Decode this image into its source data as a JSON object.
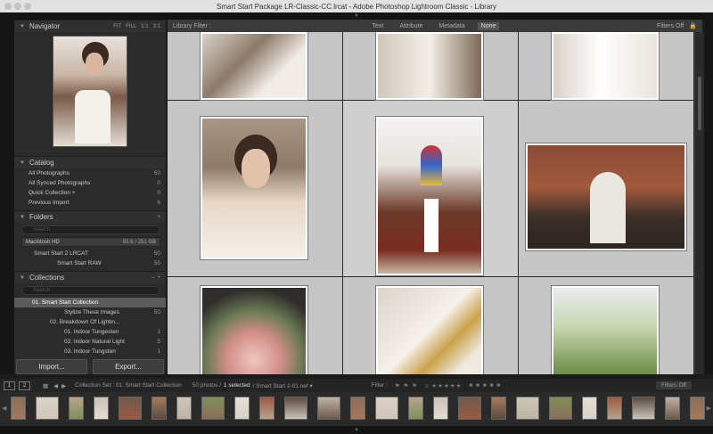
{
  "window": {
    "title": "Smart Start Package LR-Classic-CC.lrcat - Adobe Photoshop Lightroom Classic - Library"
  },
  "navigator": {
    "title": "Navigator",
    "zoom_options": [
      "FIT",
      "FILL",
      "1:1",
      "3:1"
    ]
  },
  "catalog": {
    "title": "Catalog",
    "items": [
      {
        "label": "All Photographs",
        "count": "50"
      },
      {
        "label": "All Synced Photographs",
        "count": "0"
      },
      {
        "label": "Quick Collection +",
        "count": "0"
      },
      {
        "label": "Previous Import",
        "count": "6"
      }
    ]
  },
  "folders": {
    "title": "Folders",
    "search_placeholder": "Search",
    "volume": {
      "name": "Macintosh HD",
      "space": "83.6 / 251 GB"
    },
    "items": [
      {
        "label": "Smart Start 2 LRCAT",
        "count": "50"
      },
      {
        "label": "Smart Start RAW",
        "count": "50"
      }
    ]
  },
  "collections": {
    "title": "Collections",
    "search_placeholder": "Search",
    "items": [
      {
        "label": "01. Smart Start Collection",
        "count": ""
      },
      {
        "label": "Stylize These Images",
        "count": "50"
      },
      {
        "label": "02. Breakdown Of Lightin...",
        "count": ""
      },
      {
        "label": "01. Indoor Tungesten",
        "count": "1"
      },
      {
        "label": "02. Indoor Natural Light",
        "count": "5"
      },
      {
        "label": "03. Indoor Tungsten",
        "count": "1"
      }
    ]
  },
  "buttons": {
    "import": "Import...",
    "export": "Export..."
  },
  "filter": {
    "label": "Library Filter :",
    "tabs": [
      "Text",
      "Attribute",
      "Metadata",
      "None"
    ],
    "filters_off": "Filters Off"
  },
  "toolbar": {
    "monitor1": "1",
    "monitor2": "2",
    "breadcrumb": "Collection Set : 01. Smart Start Collection",
    "photo_count": "50 photos /",
    "selected": "1 selected",
    "current_file": "/ Smart Start 2-01.nef ▾",
    "filter_label": "Filter :",
    "filters_off": "Filters Off"
  },
  "colors": {
    "accent_selected": "#5b5b5b",
    "grid_cell": "#c6c6c6"
  }
}
